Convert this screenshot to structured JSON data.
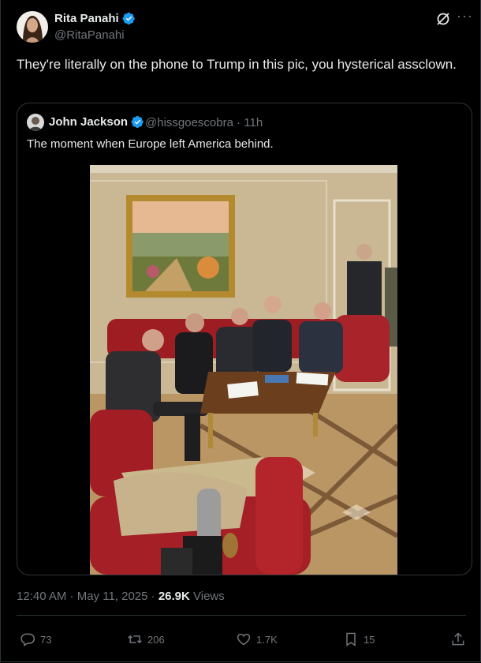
{
  "tweet": {
    "author_name": "Rita Panahi",
    "author_handle": "@RitaPanahi",
    "text": "They're literally on the phone to Trump in this pic, you hysterical assclown.",
    "timestamp": "12:40 AM · May 11, 2025 · ",
    "views_count": "26.9K",
    "views_label": " Views"
  },
  "quoted": {
    "author_name": "John Jackson",
    "author_handle": "@hissgoescobra",
    "age": "11h",
    "text": "The moment when Europe left America behind."
  },
  "actions": {
    "replies": "73",
    "reposts": "206",
    "likes": "1.7K",
    "bookmarks": "15"
  },
  "colors": {
    "background": "#000000",
    "verified": "#1d9bf0",
    "muted": "#71767b",
    "border": "#2f3336"
  }
}
